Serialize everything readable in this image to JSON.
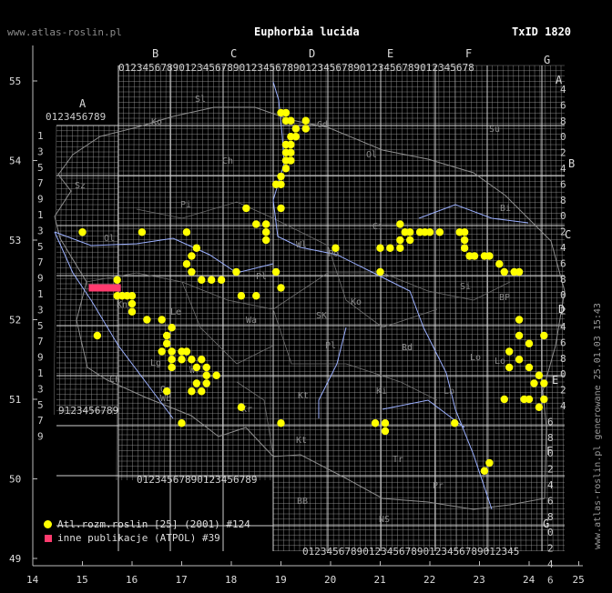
{
  "header": {
    "site": "www.atlas-roslin.pl",
    "species": "Euphorbia lucida",
    "taxid": "TxID 1820",
    "generated": "www.atlas-roslin.pl generowane 25.01.03 15:43"
  },
  "legend": {
    "atlas": "Atl.rozm.roslin [25] (2001) #124",
    "atpol": "inne publikacje (ATPOL) #39"
  },
  "colors": {
    "atlas": "#ffff00",
    "atpol": "#ff3b6e",
    "grid": "#9a9a9a",
    "rivers": "#9bb0ff"
  },
  "axes": {
    "x_ticks": [
      "14",
      "15",
      "16",
      "17",
      "18",
      "19",
      "20",
      "21",
      "22",
      "23",
      "24",
      "25"
    ],
    "y_ticks": [
      "55",
      "54",
      "53",
      "52",
      "51",
      "50",
      "49"
    ]
  },
  "atpol": {
    "columns": [
      "A",
      "B",
      "C",
      "D",
      "E",
      "F",
      "G"
    ],
    "rows": [
      "A",
      "B",
      "C",
      "D",
      "E",
      "F",
      "G"
    ],
    "digits": "0123456789"
  },
  "regions": [
    "Sl",
    "Ko",
    "Gd",
    "Ol",
    "Su",
    "Sz",
    "Ch",
    "Pi",
    "Bi",
    "Ci",
    "Wl",
    "Ol",
    "Po",
    "Pl",
    "Ko",
    "SK",
    "Lo",
    "Si",
    "Kn",
    "Le",
    "Lo",
    "Wa",
    "BP",
    "Lg",
    "Wr",
    "Pl",
    "Rd",
    "Ld",
    "Op",
    "Kt",
    "Ki",
    "Lb",
    "Wb",
    "Kr",
    "Tr",
    "BB",
    "NS",
    "Pr",
    "Kt",
    "Ch"
  ],
  "occurrences": {
    "atlas": [
      [
        19.0,
        54.6
      ],
      [
        19.1,
        54.6
      ],
      [
        19.1,
        54.5
      ],
      [
        19.2,
        54.5
      ],
      [
        19.5,
        54.5
      ],
      [
        19.5,
        54.4
      ],
      [
        19.3,
        54.4
      ],
      [
        19.2,
        54.3
      ],
      [
        19.3,
        54.3
      ],
      [
        19.1,
        54.2
      ],
      [
        19.2,
        54.2
      ],
      [
        19.1,
        54.1
      ],
      [
        19.2,
        54.1
      ],
      [
        19.1,
        54.0
      ],
      [
        19.2,
        54.0
      ],
      [
        19.1,
        53.9
      ],
      [
        19.0,
        53.8
      ],
      [
        18.9,
        53.7
      ],
      [
        19.0,
        53.7
      ],
      [
        18.3,
        53.4
      ],
      [
        19.0,
        53.4
      ],
      [
        15.0,
        53.1
      ],
      [
        16.2,
        53.1
      ],
      [
        17.1,
        53.1
      ],
      [
        18.5,
        53.2
      ],
      [
        18.7,
        53.2
      ],
      [
        18.7,
        53.1
      ],
      [
        18.7,
        53.0
      ],
      [
        20.1,
        52.9
      ],
      [
        21.0,
        52.9
      ],
      [
        21.2,
        52.9
      ],
      [
        21.4,
        53.2
      ],
      [
        21.5,
        53.1
      ],
      [
        21.6,
        53.1
      ],
      [
        21.8,
        53.1
      ],
      [
        21.9,
        53.1
      ],
      [
        22.0,
        53.1
      ],
      [
        22.2,
        53.1
      ],
      [
        21.4,
        53.0
      ],
      [
        21.6,
        53.0
      ],
      [
        21.4,
        52.9
      ],
      [
        22.6,
        53.1
      ],
      [
        22.7,
        53.1
      ],
      [
        22.7,
        53.0
      ],
      [
        22.7,
        52.9
      ],
      [
        22.8,
        52.8
      ],
      [
        22.9,
        52.8
      ],
      [
        23.1,
        52.8
      ],
      [
        23.2,
        52.8
      ],
      [
        23.4,
        52.7
      ],
      [
        23.5,
        52.6
      ],
      [
        23.7,
        52.6
      ],
      [
        23.8,
        52.6
      ],
      [
        21.0,
        52.6
      ],
      [
        17.3,
        52.9
      ],
      [
        17.2,
        52.8
      ],
      [
        17.1,
        52.7
      ],
      [
        17.2,
        52.6
      ],
      [
        17.4,
        52.5
      ],
      [
        17.8,
        52.5
      ],
      [
        17.6,
        52.5
      ],
      [
        18.1,
        52.6
      ],
      [
        18.9,
        52.6
      ],
      [
        19.0,
        52.4
      ],
      [
        18.2,
        52.3
      ],
      [
        18.5,
        52.3
      ],
      [
        15.7,
        52.5
      ],
      [
        15.7,
        52.3
      ],
      [
        15.8,
        52.3
      ],
      [
        15.9,
        52.3
      ],
      [
        16.0,
        52.3
      ],
      [
        16.0,
        52.2
      ],
      [
        16.0,
        52.1
      ],
      [
        16.3,
        52.0
      ],
      [
        16.6,
        52.0
      ],
      [
        15.3,
        51.8
      ],
      [
        16.7,
        51.8
      ],
      [
        16.8,
        51.9
      ],
      [
        16.7,
        51.7
      ],
      [
        16.8,
        51.6
      ],
      [
        17.0,
        51.6
      ],
      [
        17.1,
        51.6
      ],
      [
        17.2,
        51.5
      ],
      [
        17.0,
        51.5
      ],
      [
        16.6,
        51.6
      ],
      [
        16.8,
        51.5
      ],
      [
        16.8,
        51.4
      ],
      [
        17.3,
        51.4
      ],
      [
        17.4,
        51.5
      ],
      [
        17.5,
        51.4
      ],
      [
        17.5,
        51.3
      ],
      [
        17.7,
        51.3
      ],
      [
        17.3,
        51.2
      ],
      [
        17.2,
        51.1
      ],
      [
        17.4,
        51.1
      ],
      [
        17.5,
        51.2
      ],
      [
        16.7,
        51.1
      ],
      [
        17.0,
        50.7
      ],
      [
        18.2,
        50.9
      ],
      [
        19.0,
        50.7
      ],
      [
        20.9,
        50.7
      ],
      [
        21.1,
        50.7
      ],
      [
        21.1,
        50.6
      ],
      [
        22.5,
        50.7
      ],
      [
        23.8,
        52.0
      ],
      [
        23.8,
        51.8
      ],
      [
        23.6,
        51.6
      ],
      [
        23.8,
        51.5
      ],
      [
        24.0,
        51.7
      ],
      [
        24.3,
        51.8
      ],
      [
        23.6,
        51.4
      ],
      [
        24.0,
        51.4
      ],
      [
        24.1,
        51.2
      ],
      [
        24.2,
        51.3
      ],
      [
        24.3,
        51.2
      ],
      [
        23.5,
        51.0
      ],
      [
        23.9,
        51.0
      ],
      [
        24.0,
        51.0
      ],
      [
        24.2,
        50.9
      ],
      [
        24.3,
        51.0
      ],
      [
        23.2,
        50.2
      ],
      [
        23.1,
        50.1
      ]
    ],
    "atpol": [
      [
        15.2,
        52.4
      ],
      [
        15.3,
        52.4
      ],
      [
        15.4,
        52.4
      ],
      [
        15.5,
        52.4
      ],
      [
        15.6,
        52.4
      ],
      [
        15.7,
        52.4
      ]
    ]
  }
}
